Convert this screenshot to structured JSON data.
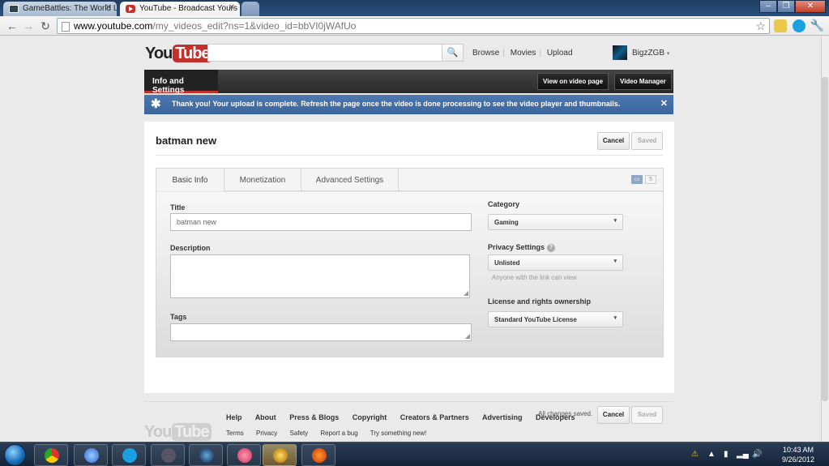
{
  "browser": {
    "tabs": [
      {
        "title": "GameBattles: The World Le"
      },
      {
        "title": "YouTube - Broadcast Yours"
      }
    ],
    "url_host": "www.youtube.com",
    "url_path": "/my_videos_edit?ns=1&video_id=bbVI0jWAfUo"
  },
  "header": {
    "logo_you": "You",
    "logo_tube": "Tube",
    "nav": [
      "Browse",
      "Movies",
      "Upload"
    ],
    "username": "BigzZGB"
  },
  "subbar": {
    "active_tab": "Info and Settings",
    "view_btn": "View on video page",
    "manager_btn": "Video Manager"
  },
  "notice": {
    "text": "Thank you! Your upload is complete. Refresh the page once the video is done processing to see the video player and thumbnails."
  },
  "video": {
    "title": "batman new",
    "cancel": "Cancel",
    "saved": "Saved"
  },
  "editor": {
    "tabs": [
      "Basic Info",
      "Monetization",
      "Advanced Settings"
    ],
    "counter": "5",
    "title_label": "Title",
    "title_value": "batman new",
    "description_label": "Description",
    "tags_label": "Tags",
    "category_label": "Category",
    "category_value": "Gaming",
    "privacy_label": "Privacy Settings",
    "privacy_value": "Unlisted",
    "privacy_hint": "Anyone with the link can view",
    "license_label": "License and rights ownership",
    "license_value": "Standard YouTube License"
  },
  "bottom": {
    "status": "All changes saved.",
    "cancel": "Cancel",
    "saved": "Saved"
  },
  "footer": {
    "links1": [
      "Help",
      "About",
      "Press & Blogs",
      "Copyright",
      "Creators & Partners",
      "Advertising",
      "Developers"
    ],
    "links2": [
      "Terms",
      "Privacy",
      "Safety",
      "Report a bug",
      "Try something new!"
    ]
  },
  "taskbar": {
    "time": "10:43 AM",
    "date": "9/26/2012"
  },
  "colors": {
    "brand_red": "#c4302b",
    "notice_blue": "#4c78b0"
  }
}
